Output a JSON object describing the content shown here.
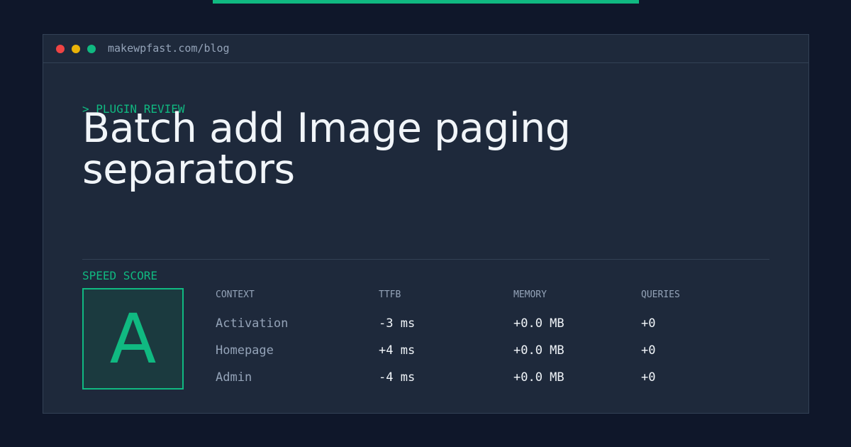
{
  "theme": {
    "accent": "#10b981",
    "background": "#0f172a",
    "panel": "#1e293b",
    "text": "#f1f5f9",
    "muted": "#94a3b8"
  },
  "window": {
    "controls": [
      "close",
      "minimize",
      "maximize"
    ],
    "url": "makewpfast.com/blog"
  },
  "article": {
    "kicker": "> PLUGIN REVIEW",
    "title": "Batch add Image paging separators"
  },
  "score": {
    "label": "SPEED SCORE",
    "grade": "A"
  },
  "table": {
    "headers": [
      "CONTEXT",
      "TTFB",
      "MEMORY",
      "QUERIES"
    ],
    "rows": [
      {
        "context": "Activation",
        "ttfb": "-3 ms",
        "memory": "+0.0 MB",
        "queries": "+0"
      },
      {
        "context": "Homepage",
        "ttfb": "+4 ms",
        "memory": "+0.0 MB",
        "queries": "+0"
      },
      {
        "context": "Admin",
        "ttfb": "-4 ms",
        "memory": "+0.0 MB",
        "queries": "+0"
      }
    ]
  }
}
